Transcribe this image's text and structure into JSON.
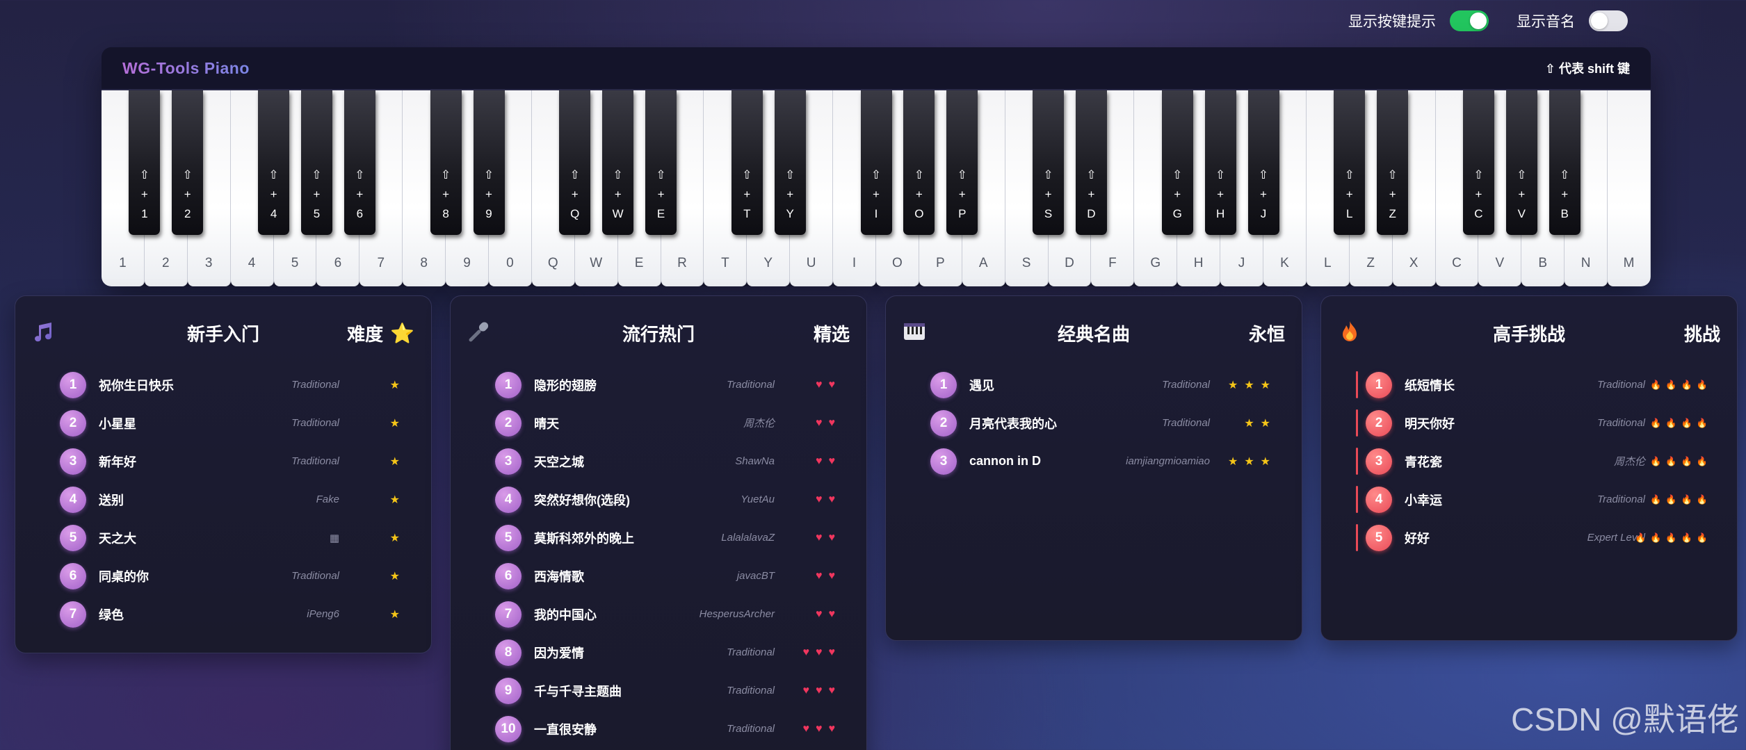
{
  "toggles": [
    {
      "label": "显示按键提示",
      "on": true
    },
    {
      "label": "显示音名",
      "on": false
    }
  ],
  "piano": {
    "title": "WG-Tools Piano",
    "shift_hint": "⇧ 代表 shift 键",
    "white_keys": [
      "1",
      "2",
      "3",
      "4",
      "5",
      "6",
      "7",
      "8",
      "9",
      "0",
      "Q",
      "W",
      "E",
      "R",
      "T",
      "Y",
      "U",
      "I",
      "O",
      "P",
      "A",
      "S",
      "D",
      "F",
      "G",
      "H",
      "J",
      "K",
      "L",
      "Z",
      "X",
      "C",
      "V",
      "B",
      "N",
      "M"
    ],
    "black_keys": [
      {
        "after": 0,
        "label": "⇧\n+\n1"
      },
      {
        "after": 1,
        "label": "⇧\n+\n2"
      },
      {
        "after": 3,
        "label": "⇧\n+\n4"
      },
      {
        "after": 4,
        "label": "⇧\n+\n5"
      },
      {
        "after": 5,
        "label": "⇧\n+\n6"
      },
      {
        "after": 7,
        "label": "⇧\n+\n8"
      },
      {
        "after": 8,
        "label": "⇧\n+\n9"
      },
      {
        "after": 10,
        "label": "⇧\n+\nQ"
      },
      {
        "after": 11,
        "label": "⇧\n+\nW"
      },
      {
        "after": 12,
        "label": "⇧\n+\nE"
      },
      {
        "after": 14,
        "label": "⇧\n+\nT"
      },
      {
        "after": 15,
        "label": "⇧\n+\nY"
      },
      {
        "after": 17,
        "label": "⇧\n+\nI"
      },
      {
        "after": 18,
        "label": "⇧\n+\nO"
      },
      {
        "after": 19,
        "label": "⇧\n+\nP"
      },
      {
        "after": 21,
        "label": "⇧\n+\nS"
      },
      {
        "after": 22,
        "label": "⇧\n+\nD"
      },
      {
        "after": 24,
        "label": "⇧\n+\nG"
      },
      {
        "after": 25,
        "label": "⇧\n+\nH"
      },
      {
        "after": 26,
        "label": "⇧\n+\nJ"
      },
      {
        "after": 28,
        "label": "⇧\n+\nL"
      },
      {
        "after": 29,
        "label": "⇧\n+\nZ"
      },
      {
        "after": 31,
        "label": "⇧\n+\nC"
      },
      {
        "after": 32,
        "label": "⇧\n+\nV"
      },
      {
        "after": 33,
        "label": "⇧\n+\nB"
      }
    ]
  },
  "cards": [
    {
      "title": "新手入门",
      "tag": "难度",
      "tag_icon": "⭐",
      "icon": "music-note-icon",
      "rating_symbol": "★",
      "rating_class": "star",
      "red": false,
      "songs": [
        {
          "num": "1",
          "name": "祝你生日快乐",
          "author": "Traditional",
          "rating": 1
        },
        {
          "num": "2",
          "name": "小星星",
          "author": "Traditional",
          "rating": 1
        },
        {
          "num": "3",
          "name": "新年好",
          "author": "Traditional",
          "rating": 1
        },
        {
          "num": "4",
          "name": "送别",
          "author": "Fake",
          "rating": 1
        },
        {
          "num": "5",
          "name": "天之大",
          "author": "▦",
          "rating": 1
        },
        {
          "num": "6",
          "name": "同桌的你",
          "author": "Traditional",
          "rating": 1
        },
        {
          "num": "7",
          "name": "绿色",
          "author": "iPeng6",
          "rating": 1
        }
      ]
    },
    {
      "title": "流行热门",
      "tag": "精选",
      "tag_icon": "",
      "icon": "microphone-icon",
      "rating_symbol": "♥",
      "rating_class": "heart",
      "red": false,
      "songs": [
        {
          "num": "1",
          "name": "隐形的翅膀",
          "author": "Traditional",
          "rating": 2
        },
        {
          "num": "2",
          "name": "晴天",
          "author": "周杰伦",
          "rating": 2
        },
        {
          "num": "3",
          "name": "天空之城",
          "author": "ShawNa",
          "rating": 2
        },
        {
          "num": "4",
          "name": "突然好想你(选段)",
          "author": "YuetAu",
          "rating": 2
        },
        {
          "num": "5",
          "name": "莫斯科郊外的晚上",
          "author": "LalalalavaZ",
          "rating": 2
        },
        {
          "num": "6",
          "name": "西海情歌",
          "author": "javacBT",
          "rating": 2
        },
        {
          "num": "7",
          "name": "我的中国心",
          "author": "HesperusArcher",
          "rating": 2
        },
        {
          "num": "8",
          "name": "因为爱情",
          "author": "Traditional",
          "rating": 3
        },
        {
          "num": "9",
          "name": "千与千寻主题曲",
          "author": "Traditional",
          "rating": 3
        },
        {
          "num": "10",
          "name": "一直很安静",
          "author": "Traditional",
          "rating": 3
        }
      ]
    },
    {
      "title": "经典名曲",
      "tag": "永恒",
      "tag_icon": "",
      "icon": "piano-icon",
      "rating_symbol": "★",
      "rating_class": "star",
      "red": false,
      "songs": [
        {
          "num": "1",
          "name": "遇见",
          "author": "Traditional",
          "rating": 3
        },
        {
          "num": "2",
          "name": "月亮代表我的心",
          "author": "Traditional",
          "rating": 2
        },
        {
          "num": "3",
          "name": "cannon in D",
          "author": "iamjiangmioamiao",
          "rating": 3
        }
      ]
    },
    {
      "title": "高手挑战",
      "tag": "挑战",
      "tag_icon": "",
      "icon": "fire-icon",
      "rating_symbol": "🔥",
      "rating_class": "fire",
      "red": true,
      "songs": [
        {
          "num": "1",
          "name": "纸短情长",
          "author": "Traditional",
          "rating": 4
        },
        {
          "num": "2",
          "name": "明天你好",
          "author": "Traditional",
          "rating": 4
        },
        {
          "num": "3",
          "name": "青花瓷",
          "author": "周杰伦",
          "rating": 4
        },
        {
          "num": "4",
          "name": "小幸运",
          "author": "Traditional",
          "rating": 4
        },
        {
          "num": "5",
          "name": "好好",
          "author": "Expert Level",
          "rating": 5
        }
      ]
    }
  ],
  "watermark": "CSDN @默语佬"
}
